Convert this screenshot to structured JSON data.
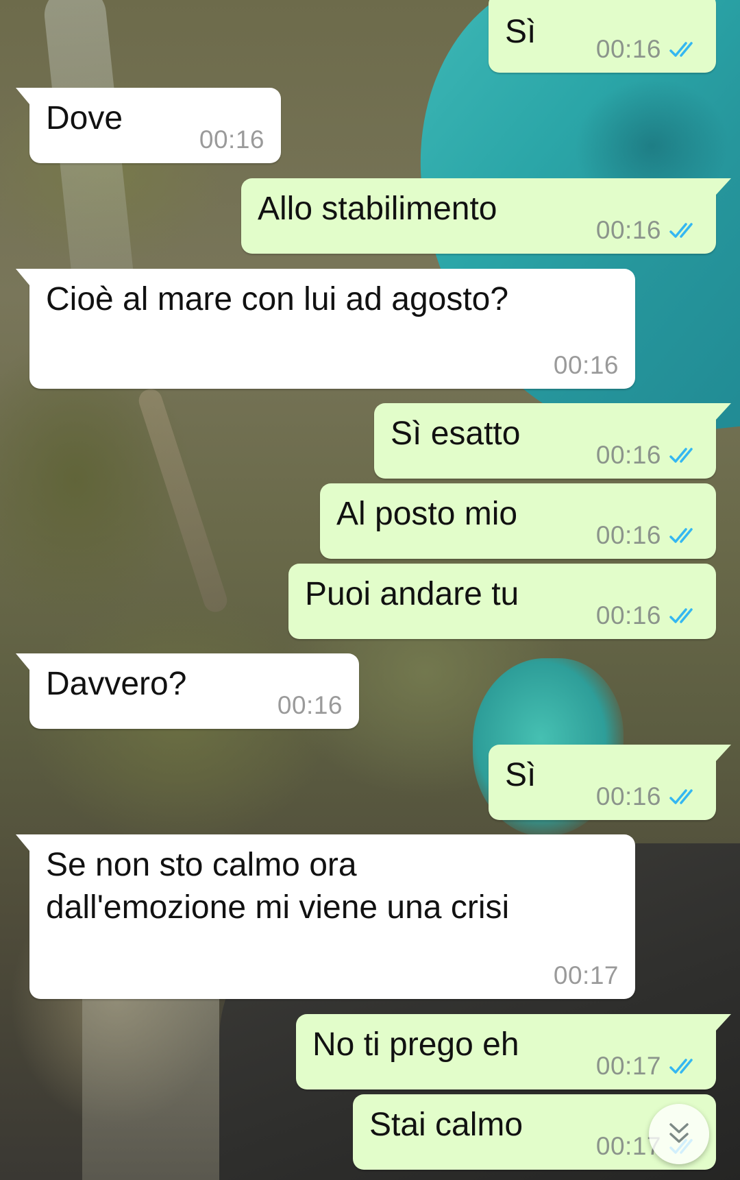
{
  "chat": {
    "colors": {
      "incoming_bubble": "#ffffff",
      "outgoing_bubble": "#e2fdca",
      "read_ticks": "#34b7f1",
      "timestamp": "#8b948b"
    },
    "messages": [
      {
        "direction": "out",
        "text": "Sì",
        "time": "00:16",
        "status": "read"
      },
      {
        "direction": "in",
        "text": "Dove",
        "time": "00:16"
      },
      {
        "direction": "out",
        "text": "Allo stabilimento",
        "time": "00:16",
        "status": "read"
      },
      {
        "direction": "in",
        "text": "Cioè al mare con lui ad agosto?",
        "time": "00:16"
      },
      {
        "direction": "out",
        "text": "Sì esatto",
        "time": "00:16",
        "status": "read"
      },
      {
        "direction": "out",
        "text": "Al posto mio",
        "time": "00:16",
        "status": "read"
      },
      {
        "direction": "out",
        "text": "Puoi andare tu",
        "time": "00:16",
        "status": "read"
      },
      {
        "direction": "in",
        "text": "Davvero?",
        "time": "00:16"
      },
      {
        "direction": "out",
        "text": "Sì",
        "time": "00:16",
        "status": "read"
      },
      {
        "direction": "in",
        "text_line1": "Se non sto calmo ora",
        "text_line2": "dall'emozione mi viene una crisi",
        "time": "00:17"
      },
      {
        "direction": "out",
        "text": "No ti prego eh",
        "time": "00:17",
        "status": "read"
      },
      {
        "direction": "out",
        "text": "Stai calmo",
        "time": "00:17",
        "status": "read"
      }
    ],
    "scroll_button": {
      "icon": "double-chevron-down-icon"
    }
  }
}
